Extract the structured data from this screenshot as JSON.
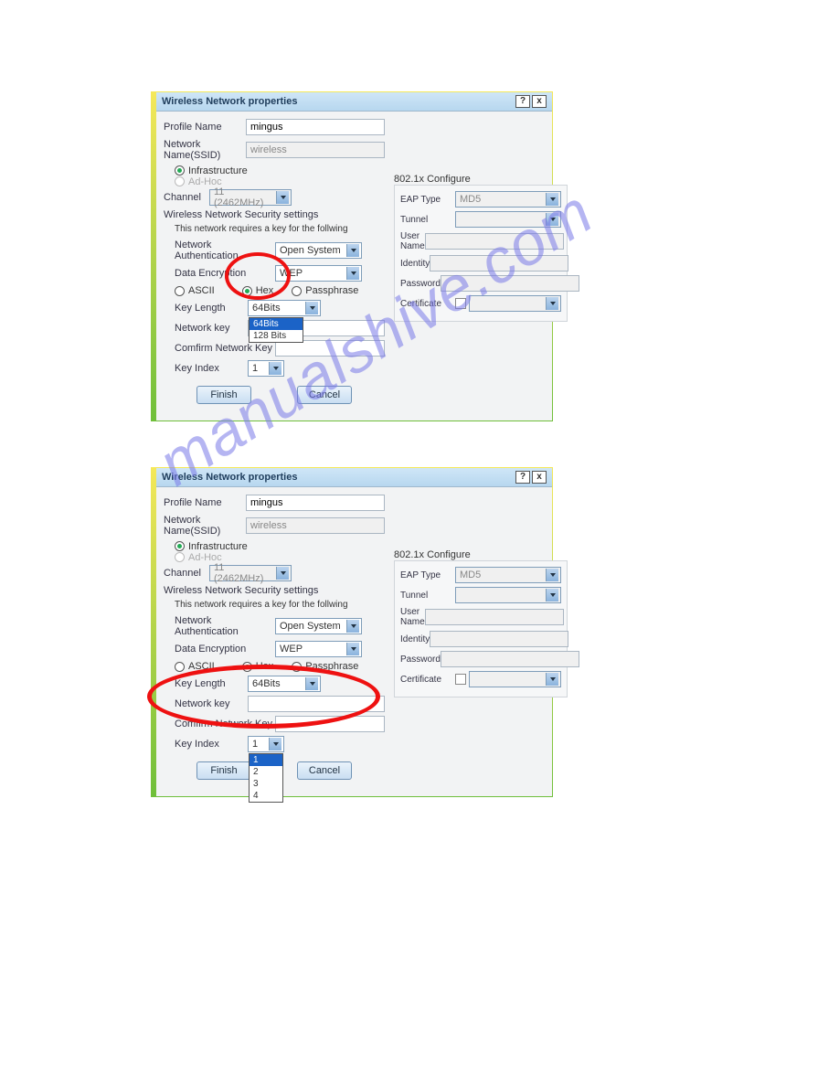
{
  "watermark": "manualshive.com",
  "dialog1": {
    "title": "Wireless Network properties",
    "help": "?",
    "close": "x",
    "profile_name_label": "Profile Name",
    "profile_name": "mingus",
    "ssid_label": "Network Name(SSID)",
    "ssid": "wireless",
    "infra_label": "Infrastructure",
    "adhoc_label": "Ad-Hoc",
    "channel_label": "Channel",
    "channel_value": "11 (2462MHz)",
    "sec_title": "Wireless Network Security settings",
    "sec_note": "This network requires a key for the follwing",
    "auth_label": "Network Authentication",
    "auth_value": "Open System",
    "enc_label": "Data Encryption",
    "enc_value": "WEP",
    "ascii_label": "ASCII",
    "hex_label": "Hex",
    "pass_label": "Passphrase",
    "keylen_label": "Key Length",
    "keylen_value": "64Bits",
    "keylen_opt1": "64Bits",
    "keylen_opt2": "128 Bits",
    "netkey_label": "Network key",
    "confirmkey_label": "Comfirm Network Key",
    "keyidx_label": "Key Index",
    "keyidx_value": "1",
    "finish": "Finish",
    "cancel": "Cancel",
    "cfg_title": "802.1x Configure",
    "eap_label": "EAP Type",
    "eap_value": "MD5",
    "tunnel_label": "Tunnel",
    "username_label": "User Name",
    "identity_label": "Identity",
    "password_label": "Password",
    "cert_label": "Certificate"
  },
  "dialog2": {
    "title": "Wireless Network properties",
    "help": "?",
    "close": "x",
    "profile_name_label": "Profile Name",
    "profile_name": "mingus",
    "ssid_label": "Network Name(SSID)",
    "ssid": "wireless",
    "infra_label": "Infrastructure",
    "adhoc_label": "Ad-Hoc",
    "channel_label": "Channel",
    "channel_value": "11 (2462MHz)",
    "sec_title": "Wireless Network Security settings",
    "sec_note": "This network requires a key for the follwing",
    "auth_label": "Network Authentication",
    "auth_value": "Open System",
    "enc_label": "Data Encryption",
    "enc_value": "WEP",
    "ascii_label": "ASCII",
    "hex_label": "Hex",
    "pass_label": "Passphrase",
    "keylen_label": "Key Length",
    "keylen_value": "64Bits",
    "netkey_label": "Network key",
    "confirmkey_label": "Comfirm Network Key",
    "keyidx_label": "Key Index",
    "keyidx_value": "1",
    "keyidx_opt1": "1",
    "keyidx_opt2": "2",
    "keyidx_opt3": "3",
    "keyidx_opt4": "4",
    "finish": "Finish",
    "cancel": "Cancel",
    "cfg_title": "802.1x Configure",
    "eap_label": "EAP Type",
    "eap_value": "MD5",
    "tunnel_label": "Tunnel",
    "username_label": "User Name",
    "identity_label": "Identity",
    "password_label": "Password",
    "cert_label": "Certificate"
  }
}
